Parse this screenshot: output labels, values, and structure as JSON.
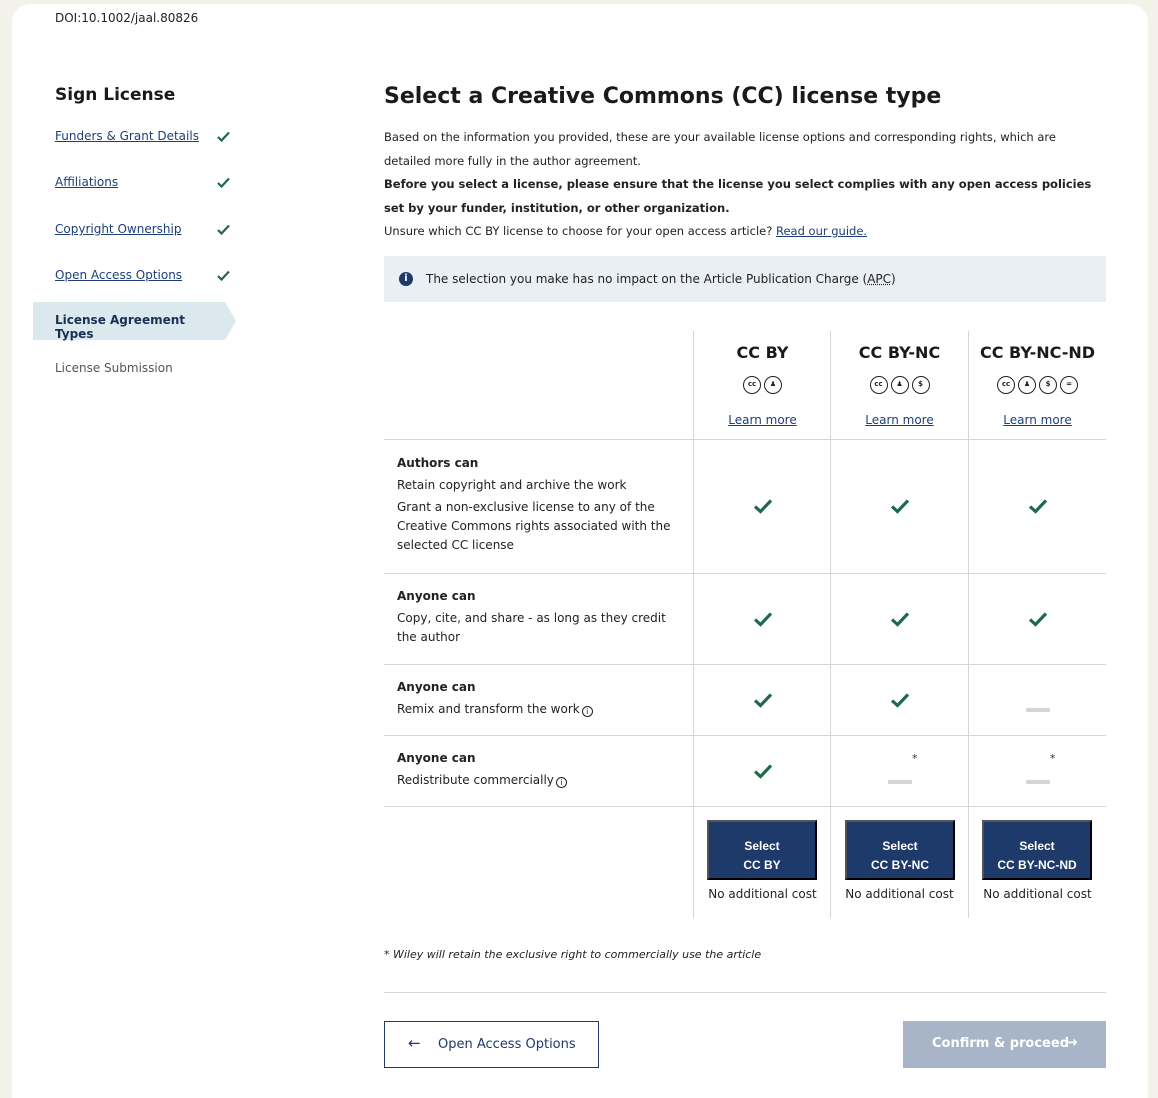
{
  "doi": "DOI:10.1002/jaal.80826",
  "sidebar": {
    "title": "Sign License",
    "steps": [
      {
        "label": "Funders & Grant Details"
      },
      {
        "label": "Affiliations"
      },
      {
        "label": "Copyright Ownership"
      },
      {
        "label": "Open Access Options"
      },
      {
        "label": "License Agreement Types"
      },
      {
        "label": "License Submission"
      }
    ]
  },
  "main": {
    "title": "Select a Creative Commons (CC) license type",
    "intro_1": "Based on the information you provided, these are your available license options and corresponding rights, which are detailed more fully in the author agreement.",
    "intro_2": "Before you select a license, please ensure that the license you select complies with any open access policies set by your funder, institution, or other organization.",
    "intro_3": "Unsure which CC BY license to choose for your open access article? ",
    "guide_link": "Read our guide.",
    "info_prefix": "The selection you make has no impact on the Article Publication Charge (",
    "info_apc": "APC",
    "info_suffix": ")"
  },
  "licenses": [
    {
      "name": "CC BY",
      "icons": [
        "cc",
        "by"
      ],
      "learn": "Learn more",
      "select_line1": "Select",
      "select_line2": "CC BY",
      "cost": "No additional cost"
    },
    {
      "name": "CC BY-NC",
      "icons": [
        "cc",
        "by",
        "nc"
      ],
      "learn": "Learn more",
      "select_line1": "Select",
      "select_line2": "CC BY-NC",
      "cost": "No additional cost"
    },
    {
      "name": "CC BY-NC-ND",
      "icons": [
        "cc",
        "by",
        "nc",
        "nd"
      ],
      "learn": "Learn more",
      "select_line1": "Select",
      "select_line2": "CC BY-NC-ND",
      "cost": "No additional cost"
    }
  ],
  "rows": [
    {
      "head": "Authors can",
      "line1": "Retain copyright and archive the work",
      "line2": "Grant a non-exclusive license to any of the Creative Commons rights associated with the selected CC license"
    },
    {
      "head": "Anyone can",
      "line1": "Copy, cite, and share - as long as they credit the author"
    },
    {
      "head": "Anyone can",
      "line1": "Remix and transform the work"
    },
    {
      "head": "Anyone can",
      "line1": "Redistribute commercially"
    }
  ],
  "asterisk": "*",
  "footnote": "* Wiley will retain the exclusive right to commercially use the article",
  "buttons": {
    "back": "Open Access Options",
    "confirm": "Confirm & proceed"
  },
  "colors": {
    "primary": "#1e3a6a",
    "check": "#1e6b4a",
    "active_step": "#dbe9ee",
    "disabled": "#a8b5c8"
  }
}
